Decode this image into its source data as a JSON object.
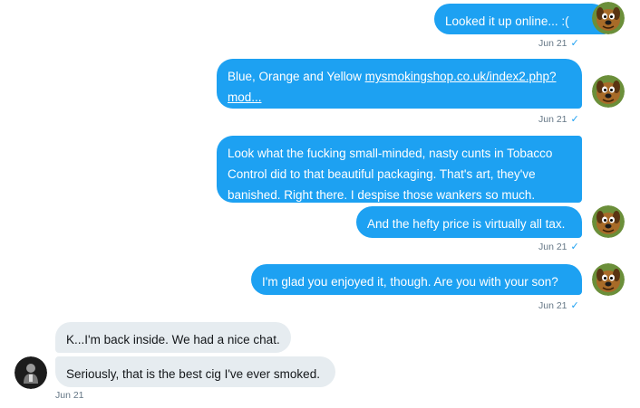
{
  "messages": [
    {
      "text": "Looked it up online... :(",
      "time": "Jun 21"
    },
    {
      "text_prefix": "Blue, Orange and Yellow ",
      "link": "mysmokingshop.co.uk/index2.php?mod...",
      "link_line1": "mysmokingshop.co.uk/index2.php?",
      "link_line2": "mod...",
      "time": "Jun 21"
    },
    {
      "line1": "Look what the fucking small-minded, nasty cunts in Tobacco",
      "line2": "Control did to that beautiful packaging. That's art, they've",
      "line3": "banished. Right there. I despise those wankers so much."
    },
    {
      "text": "And the hefty price is virtually all tax.",
      "time": "Jun 21"
    },
    {
      "text": "I'm glad you enjoyed it, though. Are you with your son?",
      "time": "Jun 21"
    }
  ],
  "incoming": [
    {
      "text": "K...I'm back inside. We had a nice chat."
    },
    {
      "text": "Seriously, that is the best cig I've ever smoked.",
      "time": "Jun 21"
    }
  ],
  "icons": {
    "read_receipt": "✓",
    "self_avatar": "cartoon-dog-avatar",
    "other_avatar": "person-avatar"
  },
  "colors": {
    "outgoing_bubble": "#1da1f2",
    "incoming_bubble": "#e6ecf0",
    "meta_text": "#657786"
  }
}
